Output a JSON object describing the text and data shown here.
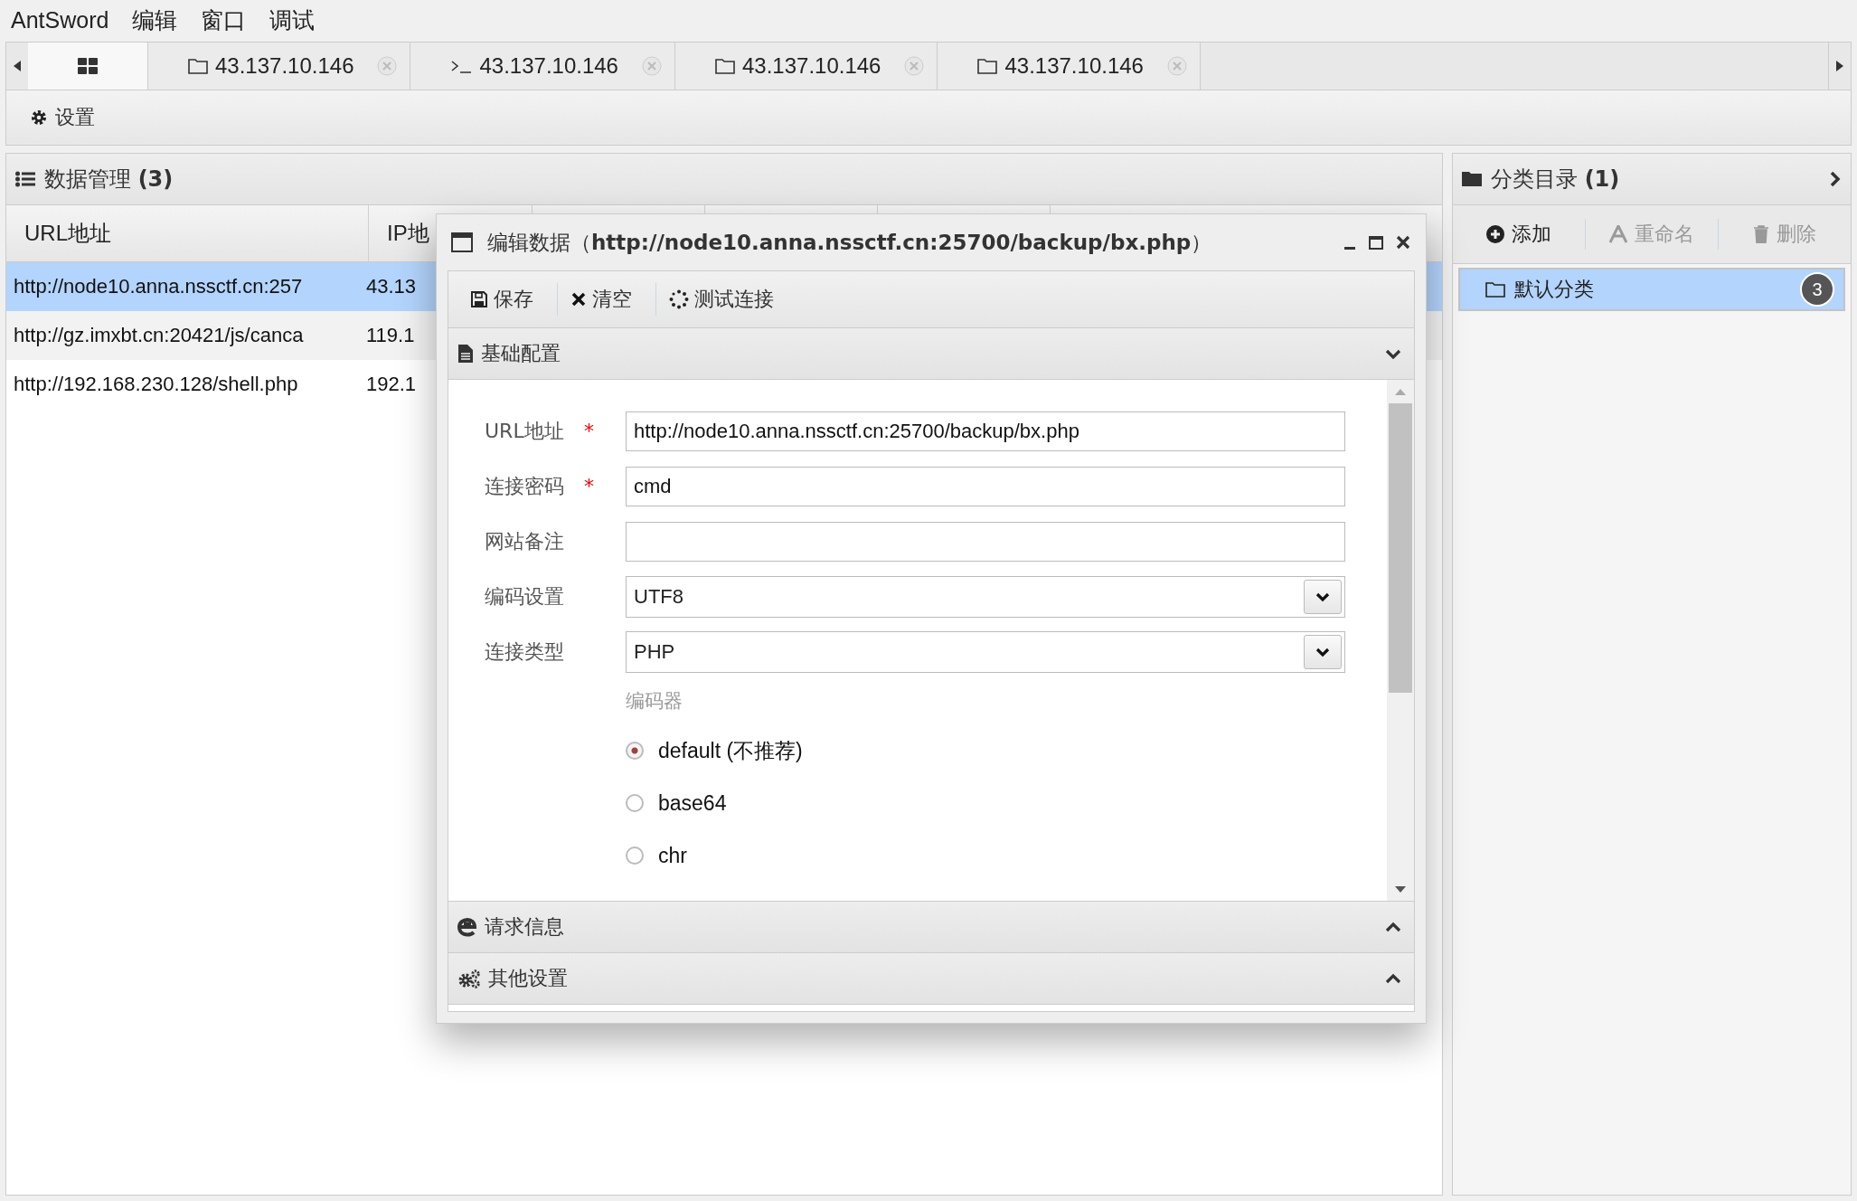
{
  "menu": [
    "AntSword",
    "编辑",
    "窗口",
    "调试"
  ],
  "tabs": [
    {
      "kind": "home",
      "selected": true
    },
    {
      "kind": "folder",
      "label": "43.137.10.146",
      "selected": false
    },
    {
      "kind": "terminal",
      "label": "43.137.10.146",
      "selected": false
    },
    {
      "kind": "folder",
      "label": "43.137.10.146",
      "selected": false
    },
    {
      "kind": "folder",
      "label": "43.137.10.146",
      "selected": false
    }
  ],
  "toolbar": {
    "settings": "设置"
  },
  "data_panel": {
    "title": "数据管理 **(3)**",
    "columns": [
      "URL地址",
      "IP地"
    ],
    "rows": [
      {
        "url": "http://node10.anna.nssctf.cn:257",
        "ip": "43.13",
        "selected": true
      },
      {
        "url": "http://gz.imxbt.cn:20421/js/canca",
        "ip": "119.1",
        "selected": false
      },
      {
        "url": "http://192.168.230.128/shell.php",
        "ip": "192.1",
        "selected": false
      }
    ]
  },
  "dialog": {
    "title": "编辑数据（**http://node10.anna.nssctf.cn:25700/backup/bx.php**）",
    "buttons": [
      {
        "kind": "save",
        "label": "保存"
      },
      {
        "kind": "clear",
        "label": "清空"
      },
      {
        "kind": "test",
        "label": "测试连接"
      }
    ],
    "sections": [
      {
        "kind": "basic",
        "title": "基础配置",
        "expanded": true
      },
      {
        "kind": "request",
        "title": "请求信息",
        "expanded": false
      },
      {
        "kind": "other",
        "title": "其他设置",
        "expanded": false
      }
    ],
    "fields": [
      {
        "kind": "text",
        "label": "URL地址",
        "required": true,
        "value": "http://node10.anna.nssctf.cn:25700/backup/bx.php"
      },
      {
        "kind": "text",
        "label": "连接密码",
        "required": true,
        "value": "cmd"
      },
      {
        "kind": "text",
        "label": "网站备注",
        "required": false
      },
      {
        "kind": "select",
        "label": "编码设置",
        "required": false,
        "value": "UTF8"
      },
      {
        "kind": "select",
        "label": "连接类型",
        "required": false,
        "value": "PHP"
      }
    ],
    "required_mark": "*",
    "encoder_label": "编码器",
    "encoders": [
      {
        "label": "default (不推荐)",
        "selected": true
      },
      {
        "label": "base64",
        "selected": false
      },
      {
        "label": "chr",
        "selected": false
      }
    ]
  },
  "category_panel": {
    "title": "分类目录 **(1)**",
    "buttons": [
      {
        "kind": "add",
        "label": "添加",
        "disabled": false
      },
      {
        "kind": "rename",
        "label": "重命名",
        "disabled": true
      },
      {
        "kind": "delete",
        "label": "删除",
        "disabled": true
      }
    ],
    "items": [
      {
        "label": "默认分类",
        "count": "3",
        "selected": true
      }
    ]
  }
}
